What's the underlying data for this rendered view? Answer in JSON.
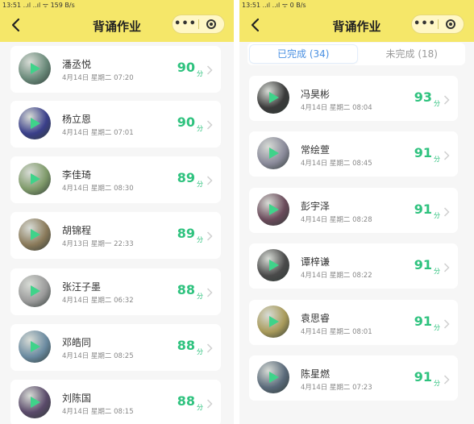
{
  "left": {
    "status_text": "13:51 ..ıl ..ıl ᯤ 159 B/s",
    "title": "背诵作业",
    "menu_dots": "•••",
    "cards": [
      {
        "name": "潘丞悦",
        "date": "4月14日 星期二 07:20",
        "score": "90",
        "unit": "分",
        "avatar": "#6a8a7a"
      },
      {
        "name": "杨立恩",
        "date": "4月14日 星期二 07:01",
        "score": "90",
        "unit": "分",
        "avatar": "#3a3f8a"
      },
      {
        "name": "李佳琦",
        "date": "4月14日 星期二 08:30",
        "score": "89",
        "unit": "分",
        "avatar": "#7f9a6a"
      },
      {
        "name": "胡锦程",
        "date": "4月13日 星期一 22:33",
        "score": "89",
        "unit": "分",
        "avatar": "#8a7a5a"
      },
      {
        "name": "张汪子墨",
        "date": "4月14日 星期二 06:32",
        "score": "88",
        "unit": "分",
        "avatar": "#9a9a9a"
      },
      {
        "name": "邓皓同",
        "date": "4月14日 星期二 08:25",
        "score": "88",
        "unit": "分",
        "avatar": "#6a8aa0"
      },
      {
        "name": "刘陈国",
        "date": "4月14日 星期二 08:15",
        "score": "88",
        "unit": "分",
        "avatar": "#5a4a6a"
      }
    ]
  },
  "right": {
    "status_text": "13:51 ..ıl ..ıl ᯤ 0 B/s",
    "title": "背诵作业",
    "menu_dots": "•••",
    "tabs": [
      {
        "label": "已完成 (34)",
        "active": true
      },
      {
        "label": "未完成 (18)",
        "active": false
      }
    ],
    "cards": [
      {
        "name": "冯昊彬",
        "date": "4月14日 星期二 08:04",
        "score": "93",
        "unit": "分",
        "avatar": "#3a3a3a"
      },
      {
        "name": "常绘萱",
        "date": "4月14日 星期二 08:45",
        "score": "91",
        "unit": "分",
        "avatar": "#8a8a9a"
      },
      {
        "name": "彭宇泽",
        "date": "4月14日 星期二 08:28",
        "score": "91",
        "unit": "分",
        "avatar": "#6a4a5a"
      },
      {
        "name": "谭梓谦",
        "date": "4月14日 星期二 08:22",
        "score": "91",
        "unit": "分",
        "avatar": "#4a4a4a"
      },
      {
        "name": "袁思睿",
        "date": "4月14日 星期二 08:01",
        "score": "91",
        "unit": "分",
        "avatar": "#a89a5a"
      },
      {
        "name": "陈星燃",
        "date": "4月14日 星期二 07:23",
        "score": "91",
        "unit": "分",
        "avatar": "#5a6a7a"
      }
    ]
  }
}
